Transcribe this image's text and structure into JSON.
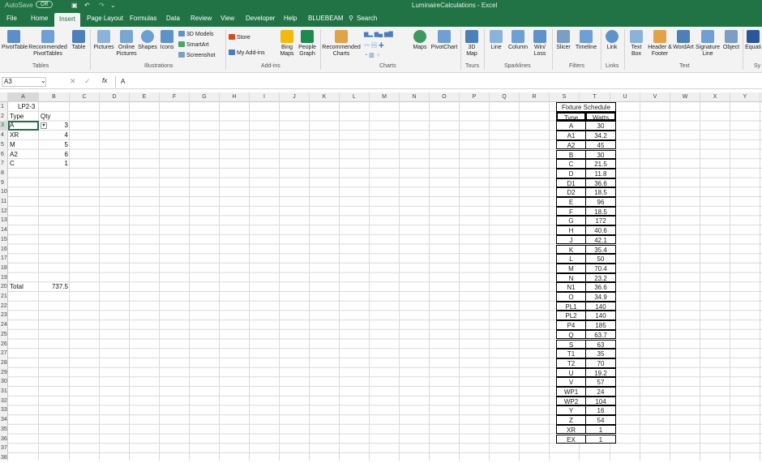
{
  "title_bar": {
    "autosave": "AutoSave",
    "autosave_state": "Off",
    "title": "LuminaireCalculations - Excel"
  },
  "tabs": [
    "File",
    "Home",
    "Insert",
    "Page Layout",
    "Formulas",
    "Data",
    "Review",
    "View",
    "Developer",
    "Help",
    "BLUEBEAM"
  ],
  "search": "Search",
  "ribbon": {
    "pivottable": "PivotTable",
    "recommended_pivot": "Recommended PivotTables",
    "table": "Table",
    "tables_group": "Tables",
    "pictures": "Pictures",
    "online_pictures": "Online Pictures",
    "shapes": "Shapes",
    "icons": "Icons",
    "models3d": "3D Models",
    "smartart": "SmartArt",
    "screenshot": "Screenshot",
    "illustrations_group": "Illustrations",
    "store": "Store",
    "my_addins": "My Add-ins",
    "bing_maps": "Bing Maps",
    "people_graph": "People Graph",
    "addins_group": "Add-ins",
    "recommended_charts": "Recommended Charts",
    "maps": "Maps",
    "pivotchart": "PivotChart",
    "charts_group": "Charts",
    "map3d": "3D Map",
    "tours_group": "Tours",
    "line": "Line",
    "column": "Column",
    "winloss": "Win/ Loss",
    "sparklines_group": "Sparklines",
    "slicer": "Slicer",
    "timeline": "Timeline",
    "filters_group": "Filters",
    "link": "Link",
    "links_group": "Links",
    "text_box": "Text Box",
    "header_footer": "Header & Footer",
    "wordart": "WordArt",
    "signature_line": "Signature Line",
    "object": "Object",
    "text_group": "Text",
    "equation": "Equati",
    "symbols_group": "Sy"
  },
  "formula_bar": {
    "name_box": "A3",
    "fx": "fx",
    "value": "A"
  },
  "columns": [
    "A",
    "B",
    "C",
    "D",
    "E",
    "F",
    "G",
    "H",
    "I",
    "J",
    "K",
    "L",
    "M",
    "N",
    "O",
    "P",
    "Q",
    "R",
    "S",
    "T",
    "U",
    "V",
    "W",
    "X",
    "Y"
  ],
  "rows": [
    "1",
    "2",
    "3",
    "4",
    "5",
    "6",
    "7",
    "8",
    "9",
    "10",
    "11",
    "12",
    "13",
    "14",
    "15",
    "16",
    "17",
    "18",
    "19",
    "20",
    "21",
    "22",
    "23",
    "24",
    "25",
    "26",
    "27",
    "28",
    "29",
    "30",
    "31",
    "32",
    "33",
    "34",
    "35",
    "36",
    "37",
    "38"
  ],
  "sheet": {
    "b1": "LP2-3",
    "a2": "Type",
    "b2": "Qty",
    "data": [
      {
        "type": "A",
        "qty": "3"
      },
      {
        "type": "XR",
        "qty": "4"
      },
      {
        "type": "M",
        "qty": "5"
      },
      {
        "type": "A2",
        "qty": "6"
      },
      {
        "type": "C",
        "qty": "1"
      }
    ],
    "total_label": "Total",
    "total_value": "737.5"
  },
  "fixture_schedule": {
    "title": "Fixture Schedule",
    "type_header": "Type",
    "watts_header": "Watts",
    "rows": [
      {
        "type": "A",
        "watts": "30"
      },
      {
        "type": "A1",
        "watts": "34.2"
      },
      {
        "type": "A2",
        "watts": "45"
      },
      {
        "type": "B",
        "watts": "30"
      },
      {
        "type": "C",
        "watts": "21.5"
      },
      {
        "type": "D",
        "watts": "11.8"
      },
      {
        "type": "D1",
        "watts": "36.6"
      },
      {
        "type": "D2",
        "watts": "18.5"
      },
      {
        "type": "E",
        "watts": "96"
      },
      {
        "type": "F",
        "watts": "18.5"
      },
      {
        "type": "G",
        "watts": "172"
      },
      {
        "type": "H",
        "watts": "40.6"
      },
      {
        "type": "J",
        "watts": "42.1"
      },
      {
        "type": "K",
        "watts": "35.4"
      },
      {
        "type": "L",
        "watts": "50"
      },
      {
        "type": "M",
        "watts": "70.4"
      },
      {
        "type": "N",
        "watts": "23.2"
      },
      {
        "type": "N1",
        "watts": "36.6"
      },
      {
        "type": "O",
        "watts": "34.9"
      },
      {
        "type": "PL1",
        "watts": "140"
      },
      {
        "type": "PL2",
        "watts": "140"
      },
      {
        "type": "P4",
        "watts": "185"
      },
      {
        "type": "Q",
        "watts": "63.7"
      },
      {
        "type": "S",
        "watts": "63"
      },
      {
        "type": "T1",
        "watts": "35"
      },
      {
        "type": "T2",
        "watts": "70"
      },
      {
        "type": "U",
        "watts": "19.2"
      },
      {
        "type": "V",
        "watts": "57"
      },
      {
        "type": "WP1",
        "watts": "24"
      },
      {
        "type": "WP2",
        "watts": "104"
      },
      {
        "type": "Y",
        "watts": "16"
      },
      {
        "type": "Z",
        "watts": "54"
      },
      {
        "type": "XR",
        "watts": "1"
      },
      {
        "type": "EX",
        "watts": "1"
      }
    ]
  },
  "colors": {
    "brand": "#217346",
    "ribbon": "#f3f3f3",
    "grid": "#dadada"
  }
}
